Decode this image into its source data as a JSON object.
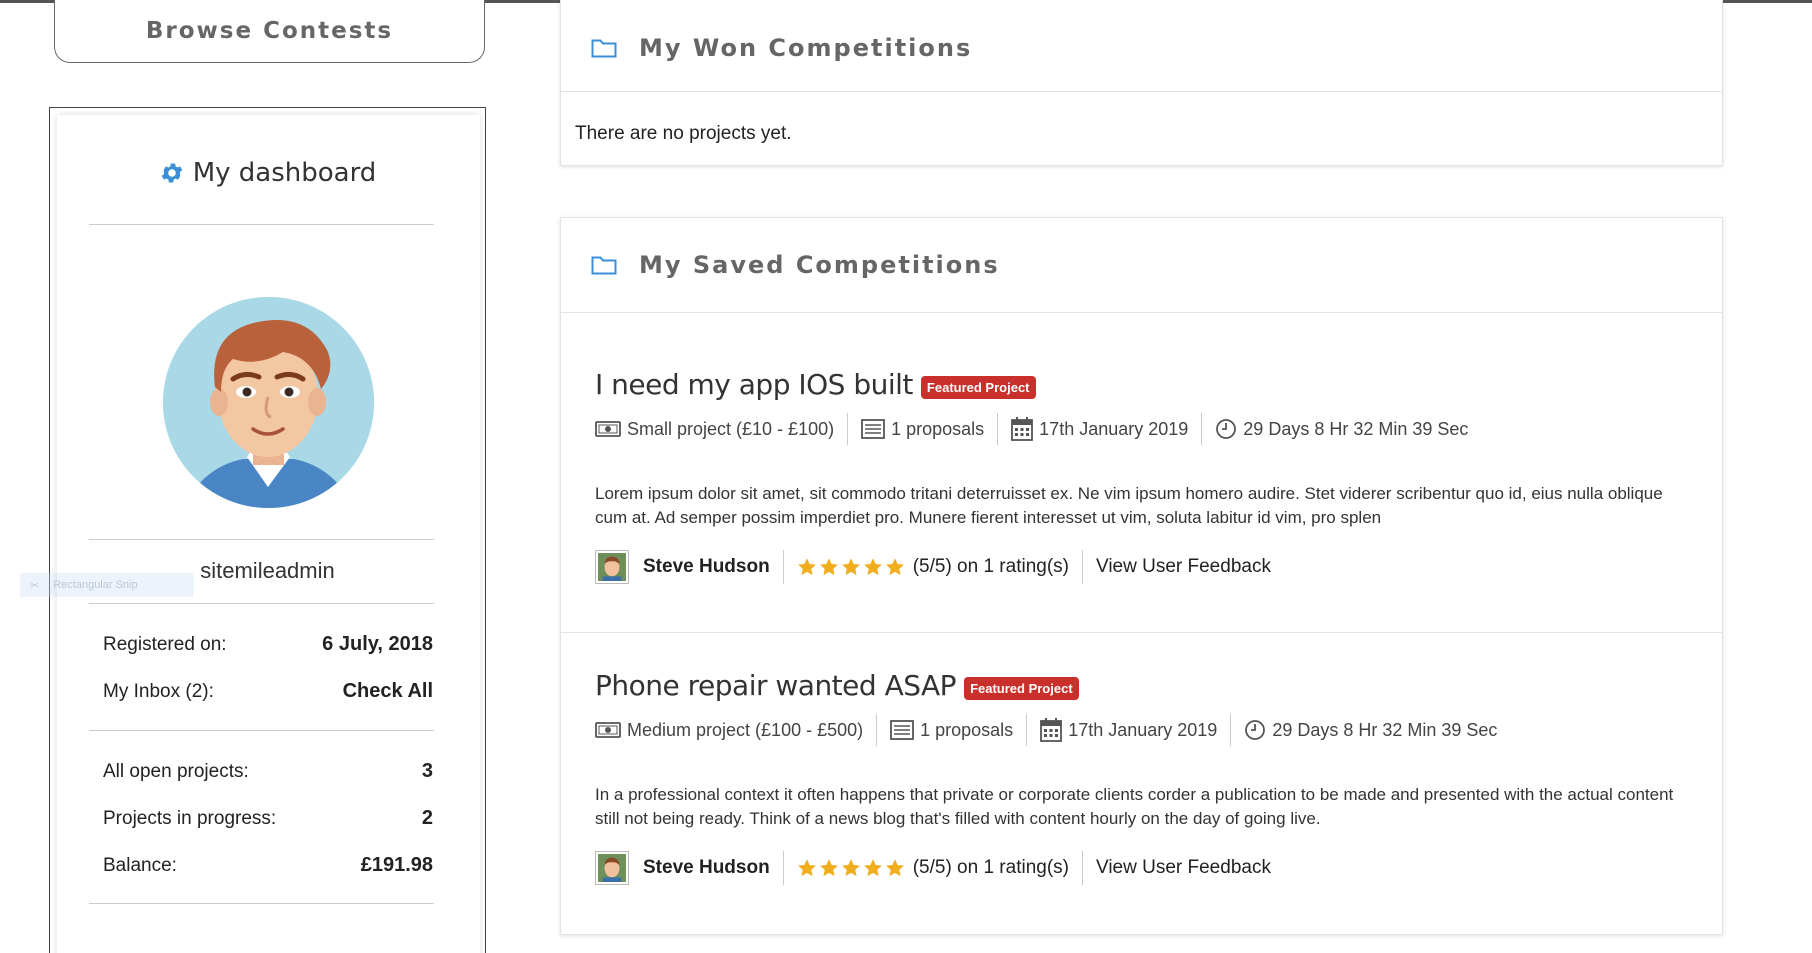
{
  "sidebar": {
    "browse_label": "Browse Contests",
    "dashboard_title": "My dashboard",
    "username": "sitemileadmin",
    "snip_label": "Rectangular Snip",
    "stats": [
      {
        "label": "Registered on:",
        "value": "6 July, 2018"
      },
      {
        "label": "My Inbox (2):",
        "value": "Check All"
      },
      {
        "label": "All open projects:",
        "value": "3"
      },
      {
        "label": "Projects in progress:",
        "value": "2"
      },
      {
        "label": "Balance:",
        "value": "£191.98"
      }
    ]
  },
  "won": {
    "title": "My Won Competitions",
    "empty_text": "There are no projects yet."
  },
  "saved": {
    "title": "My Saved Competitions",
    "projects": [
      {
        "title": "I need my app IOS built",
        "badge": "Featured Project",
        "budget": "Small project (£10 - £100)",
        "proposals": "1 proposals",
        "date": "17th January 2019",
        "time_left": "29 Days 8 Hr 32 Min 39 Sec",
        "description": "Lorem ipsum dolor sit amet, sit commodo tritani deterruisset ex. Ne vim ipsum homero audire. Stet viderer scribentur quo id, eius nulla oblique cum at. Ad semper possim imperdiet pro. Munere fierent interesset ut vim, soluta labitur id vim, pro splen",
        "user": "Steve Hudson",
        "rating": "(5/5) on 1 rating(s)",
        "rating_value": 5,
        "feedback_link": "View User Feedback"
      },
      {
        "title": "Phone repair wanted ASAP",
        "badge": "Featured Project",
        "budget": "Medium project (£100 - £500)",
        "proposals": "1 proposals",
        "date": "17th January 2019",
        "time_left": "29 Days 8 Hr 32 Min 39 Sec",
        "description": "In a professional context it often happens that private or corporate clients corder a publication to be made and presented with the actual content still not being ready. Think of a news blog that's filled with content hourly on the day of going live.",
        "user": "Steve Hudson",
        "rating": "(5/5) on 1 rating(s)",
        "rating_value": 5,
        "feedback_link": "View User Feedback"
      }
    ]
  },
  "colors": {
    "badge": "#c9302c",
    "star": "#f0ad1e",
    "folder_icon": "#3a8fd6",
    "gear_icon": "#3a8fd6"
  }
}
